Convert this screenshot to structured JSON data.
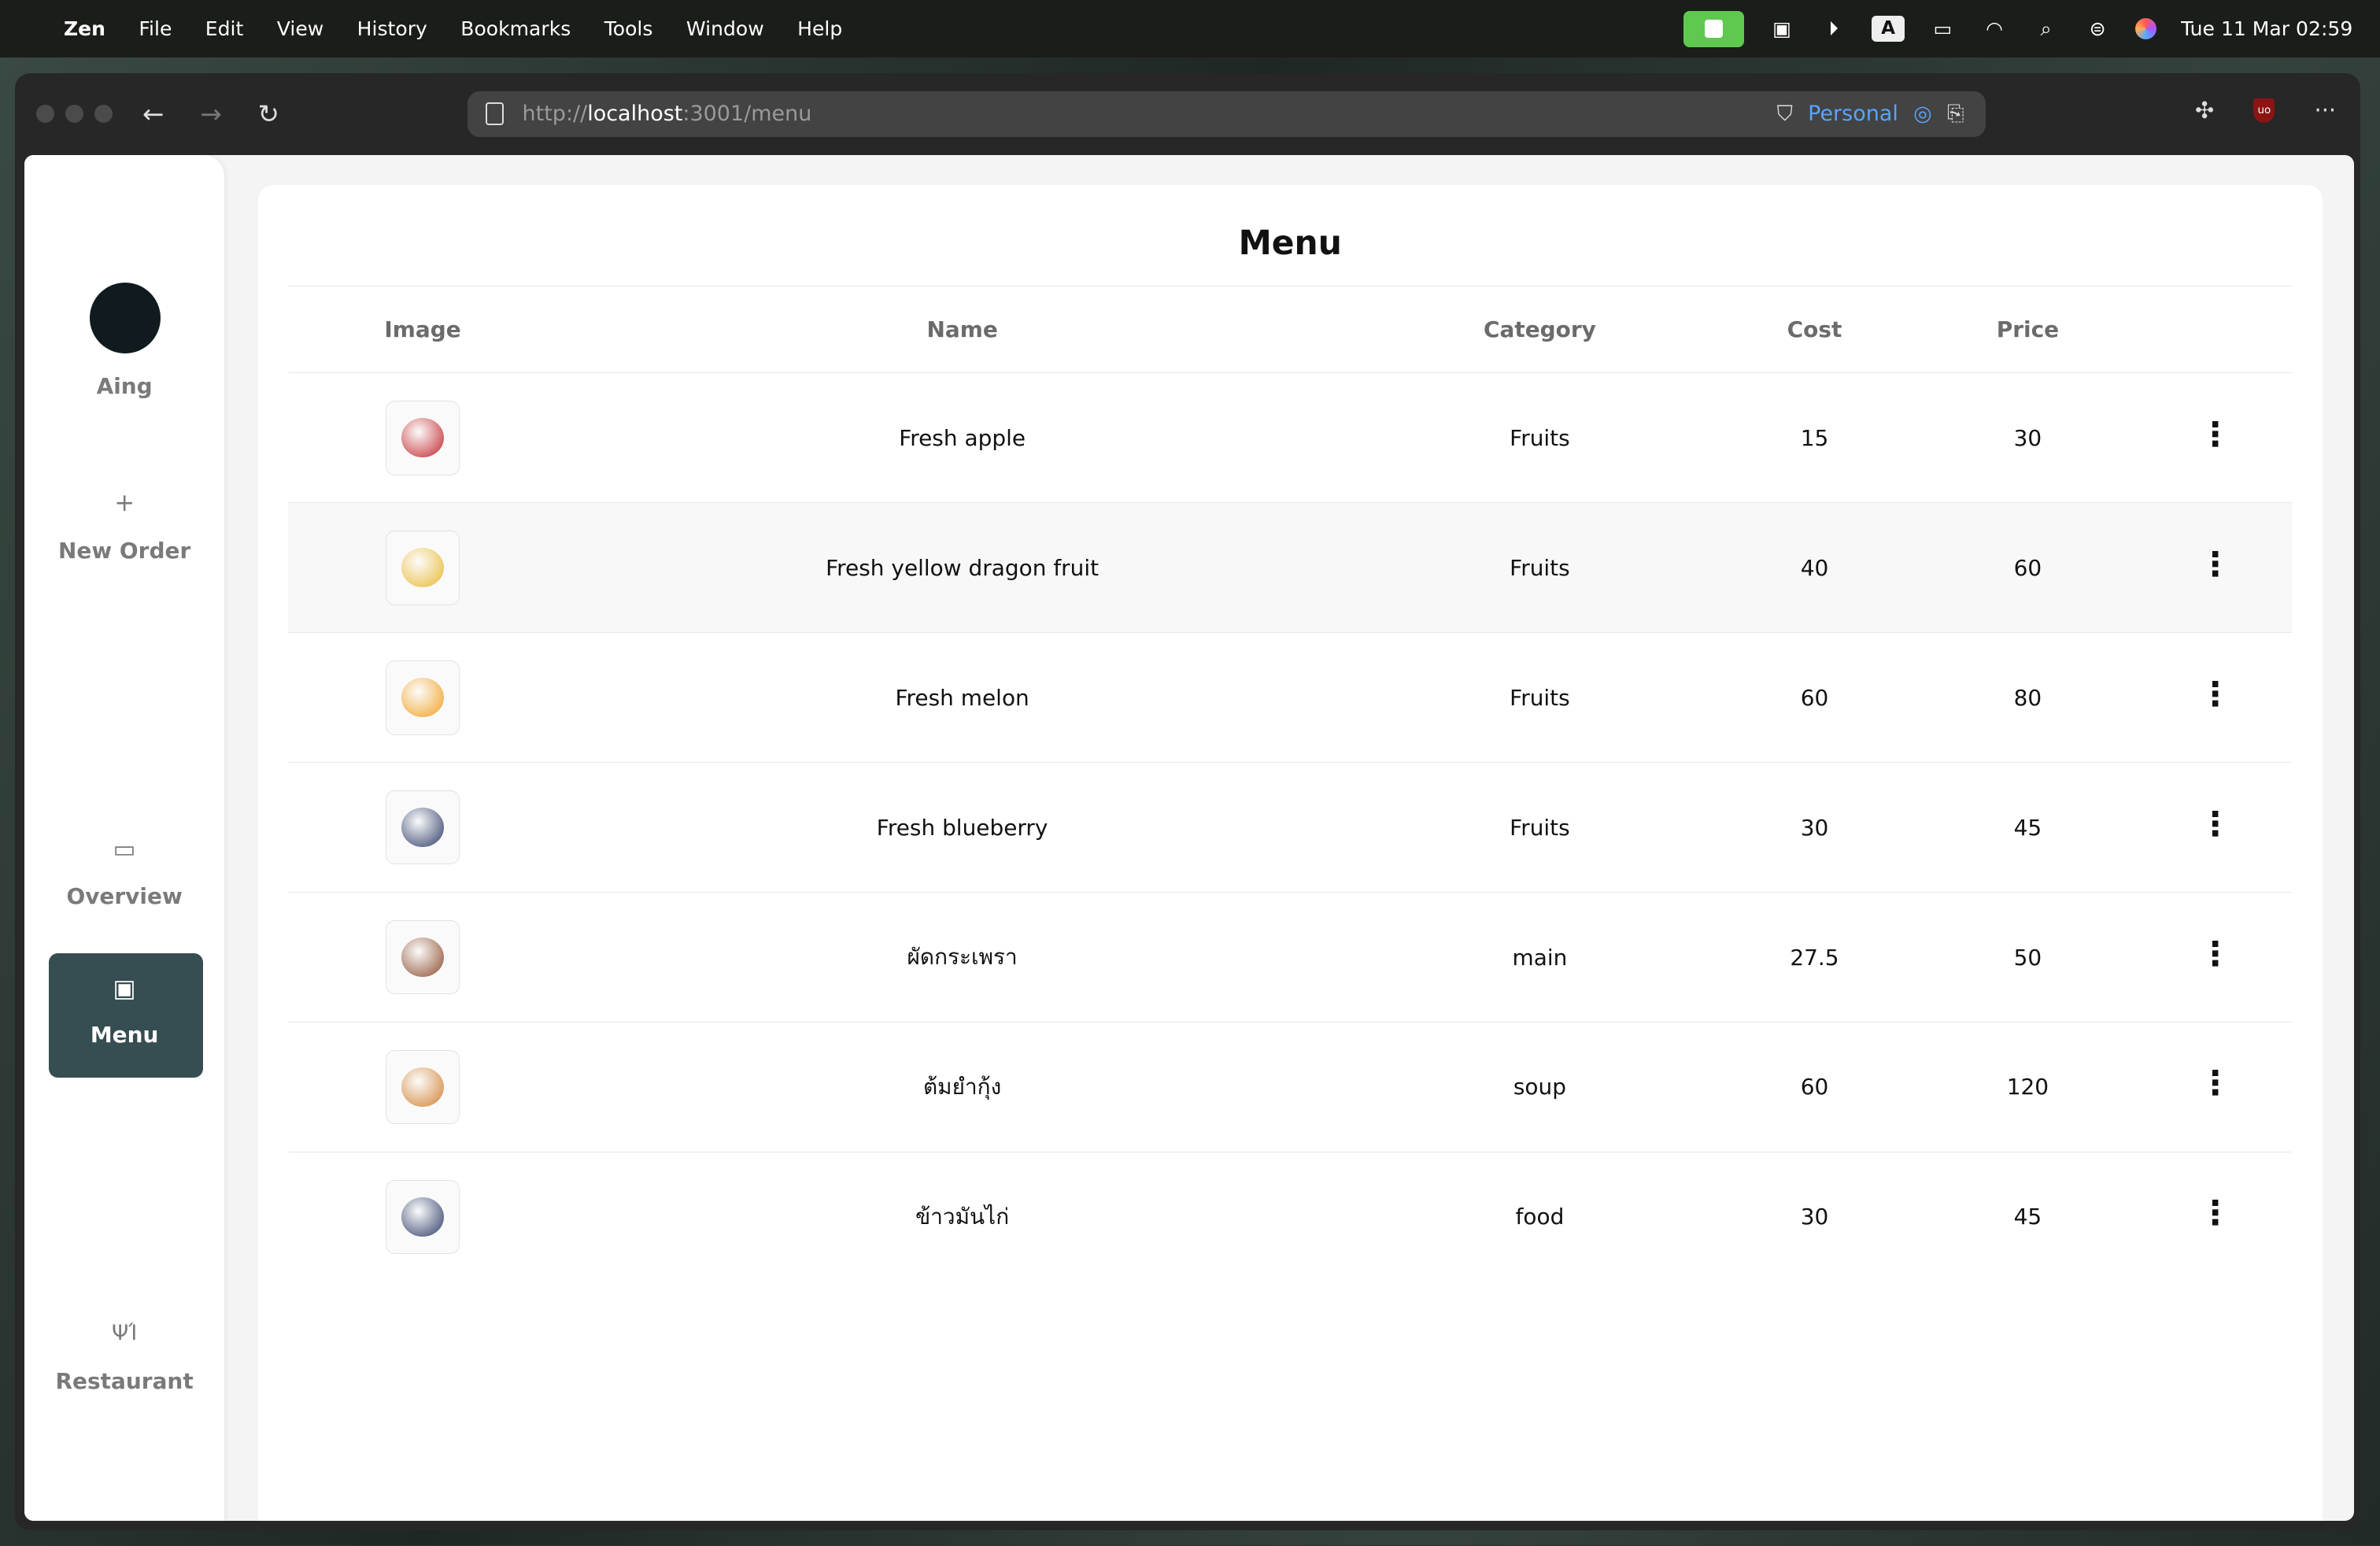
{
  "menubar": {
    "app": "Zen",
    "items": [
      "File",
      "Edit",
      "View",
      "History",
      "Bookmarks",
      "Tools",
      "Window",
      "Help"
    ],
    "clock": "Tue 11 Mar  02:59",
    "input_source": "A"
  },
  "browser": {
    "url_prefix": "http://",
    "url_host": "localhost",
    "url_rest": ":3001/menu",
    "profile": "Personal"
  },
  "sidebar": {
    "user": "Aing",
    "items": [
      {
        "label": "New Order",
        "icon": "+"
      },
      {
        "label": "Overview",
        "icon": "▭"
      },
      {
        "label": "Menu",
        "icon": "▣"
      },
      {
        "label": "Restaurant",
        "icon": "ΨΊ"
      }
    ]
  },
  "main": {
    "title": "Menu",
    "columns": [
      "Image",
      "Name",
      "Category",
      "Cost",
      "Price"
    ],
    "rows": [
      {
        "name": "Fresh apple",
        "category": "Fruits",
        "cost": "15",
        "price": "30",
        "color": "#c0242a"
      },
      {
        "name": "Fresh yellow dragon fruit",
        "category": "Fruits",
        "cost": "40",
        "price": "60",
        "color": "#e8b830"
      },
      {
        "name": "Fresh melon",
        "category": "Fruits",
        "cost": "60",
        "price": "80",
        "color": "#f0a020"
      },
      {
        "name": "Fresh blueberry",
        "category": "Fruits",
        "cost": "30",
        "price": "45",
        "color": "#2c3a66"
      },
      {
        "name": "ผัดกระเพรา",
        "category": "main",
        "cost": "27.5",
        "price": "50",
        "color": "#8a4a2a"
      },
      {
        "name": "ต้มยำกุ้ง",
        "category": "soup",
        "cost": "60",
        "price": "120",
        "color": "#d08030"
      },
      {
        "name": "ข้าวมันไก่",
        "category": "food",
        "cost": "30",
        "price": "45",
        "color": "#2c3a66"
      }
    ]
  }
}
